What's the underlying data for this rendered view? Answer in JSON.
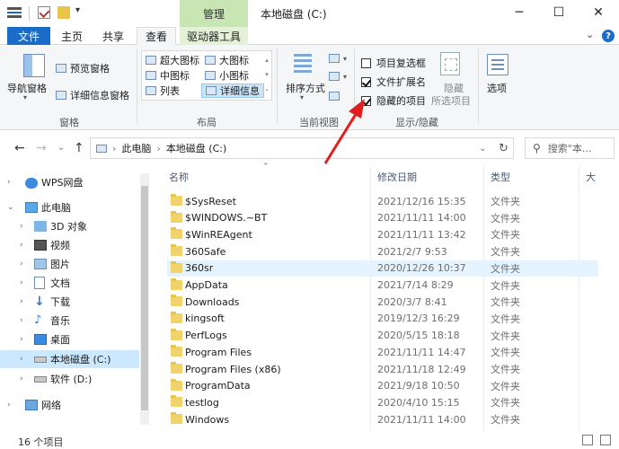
{
  "titlebar": {
    "manage_tab": "管理",
    "title": "本地磁盘 (C:)",
    "dropdown_glyph": "▾",
    "minimize": "─",
    "maximize": "☐",
    "close": "✕"
  },
  "tabs": {
    "file": "文件",
    "home": "主页",
    "share": "共享",
    "view": "查看",
    "drive_tools": "驱动器工具",
    "collapse_glyph": "⌄"
  },
  "ribbon": {
    "panes": {
      "nav_pane": "导航窗格",
      "preview_pane": "预览窗格",
      "details_pane": "详细信息窗格",
      "group_label": "窗格"
    },
    "layout": {
      "items": [
        "超大图标",
        "大图标",
        "中图标",
        "小图标",
        "列表",
        "详细信息"
      ],
      "group_label": "布局"
    },
    "current_view": {
      "sort_by": "排序方式",
      "group_label": "当前视图"
    },
    "show_hide": {
      "item_checkboxes": "项目复选框",
      "file_extensions": "文件扩展名",
      "hidden_items": "隐藏的项目",
      "hide_selected_line1": "隐藏",
      "hide_selected_line2": "所选项目",
      "group_label": "显示/隐藏",
      "checkbox_states": [
        false,
        true,
        true
      ]
    },
    "options": "选项"
  },
  "address": {
    "back": "←",
    "forward": "→",
    "recent": "⌄",
    "up": "↑",
    "crumbs": [
      "此电脑",
      "本地磁盘 (C:)"
    ],
    "sep": "›",
    "refresh": "↻",
    "search_placeholder": "搜索\"本..."
  },
  "navpane": {
    "items": [
      {
        "label": "WPS网盘",
        "icon": "cloud-icon"
      },
      {
        "label": "此电脑",
        "icon": "computer-icon"
      },
      {
        "label": "3D 对象",
        "icon": "cube-icon"
      },
      {
        "label": "视频",
        "icon": "video-icon"
      },
      {
        "label": "图片",
        "icon": "picture-icon"
      },
      {
        "label": "文档",
        "icon": "document-icon"
      },
      {
        "label": "下载",
        "icon": "download-icon"
      },
      {
        "label": "音乐",
        "icon": "music-icon"
      },
      {
        "label": "桌面",
        "icon": "desktop-icon"
      },
      {
        "label": "本地磁盘 (C:)",
        "icon": "drive-icon"
      },
      {
        "label": "软件 (D:)",
        "icon": "drive-icon"
      },
      {
        "label": "网络",
        "icon": "network-icon"
      }
    ]
  },
  "content": {
    "columns": [
      "名称",
      "修改日期",
      "类型",
      "大"
    ],
    "files": [
      {
        "name": "$SysReset",
        "date": "2021/12/16 15:35",
        "type": "文件夹"
      },
      {
        "name": "$WINDOWS.~BT",
        "date": "2021/11/11 14:00",
        "type": "文件夹"
      },
      {
        "name": "$WinREAgent",
        "date": "2021/11/11 13:42",
        "type": "文件夹"
      },
      {
        "name": "360Safe",
        "date": "2021/2/7 9:53",
        "type": "文件夹"
      },
      {
        "name": "360sr",
        "date": "2020/12/26 10:37",
        "type": "文件夹"
      },
      {
        "name": "AppData",
        "date": "2021/7/14 8:29",
        "type": "文件夹"
      },
      {
        "name": "Downloads",
        "date": "2020/3/7 8:41",
        "type": "文件夹"
      },
      {
        "name": "kingsoft",
        "date": "2019/12/3 16:29",
        "type": "文件夹"
      },
      {
        "name": "PerfLogs",
        "date": "2020/5/15 18:18",
        "type": "文件夹"
      },
      {
        "name": "Program Files",
        "date": "2021/11/11 14:47",
        "type": "文件夹"
      },
      {
        "name": "Program Files (x86)",
        "date": "2021/11/18 12:49",
        "type": "文件夹"
      },
      {
        "name": "ProgramData",
        "date": "2021/9/18 10:50",
        "type": "文件夹"
      },
      {
        "name": "testlog",
        "date": "2020/4/10 15:15",
        "type": "文件夹"
      },
      {
        "name": "Windows",
        "date": "2021/11/11 14:00",
        "type": "文件夹"
      }
    ]
  },
  "status": {
    "count": "16 个项目"
  },
  "colors": {
    "accent": "#1a6cc7",
    "manage_tab": "#c8e6b4",
    "selection": "#cce8ff",
    "annotation_arrow": "#e02020"
  }
}
